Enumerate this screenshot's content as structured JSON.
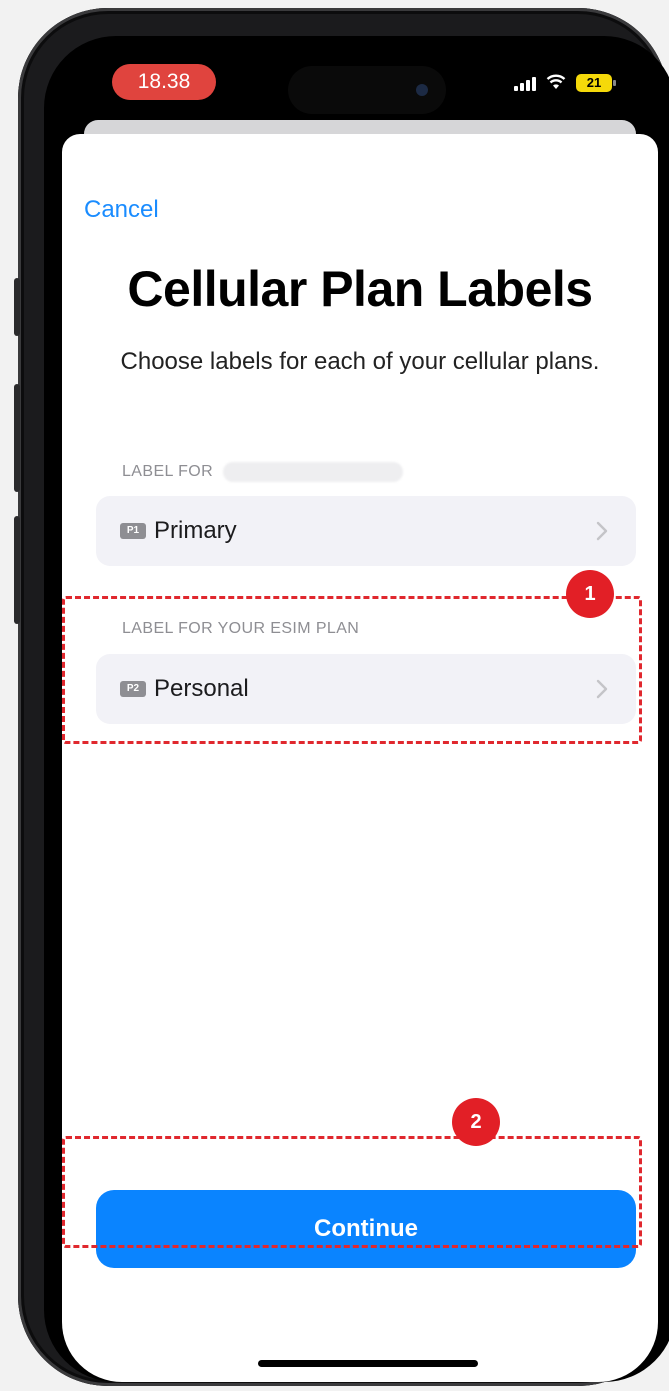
{
  "status_bar": {
    "time": "18.38",
    "battery": "21"
  },
  "nav": {
    "cancel_label": "Cancel"
  },
  "header": {
    "title": "Cellular Plan Labels",
    "subtitle": "Choose labels for each of your cellular plans."
  },
  "plans": [
    {
      "section_label": "LABEL FOR",
      "icon_text": "P1",
      "label": "Primary"
    },
    {
      "section_label": "LABEL FOR YOUR ESIM PLAN",
      "icon_text": "P2",
      "label": "Personal"
    }
  ],
  "actions": {
    "continue_label": "Continue"
  },
  "annotations": {
    "marker_1": "1",
    "marker_2": "2"
  },
  "colors": {
    "accent": "#0a84ff",
    "annotation": "#e0282e",
    "time_pill": "#e0443e"
  }
}
